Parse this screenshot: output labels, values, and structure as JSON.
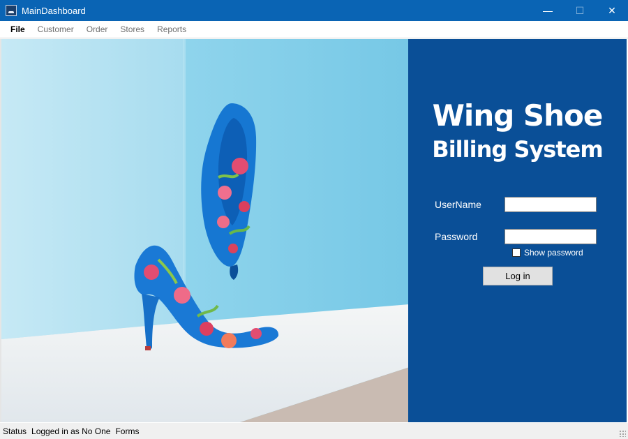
{
  "window": {
    "title": "MainDashboard",
    "minimize_symbol": "—",
    "maximize_symbol": "☐",
    "close_symbol": "✕"
  },
  "menu": {
    "items": [
      {
        "label": "File",
        "active": true
      },
      {
        "label": "Customer"
      },
      {
        "label": "Order"
      },
      {
        "label": "Stores"
      },
      {
        "label": "Reports"
      }
    ]
  },
  "login": {
    "title": "Wing Shoe",
    "subtitle": "Billing System",
    "username_label": "UserName",
    "username_value": "",
    "password_label": "Password",
    "password_value": "",
    "show_password_label": "Show password",
    "show_password_checked": false,
    "login_button": "Log in"
  },
  "status": {
    "label": "Status",
    "logged_in": "Logged in as No One",
    "forms": "Forms"
  },
  "icons": {
    "app": "app-shoe-icon",
    "resize": "resize-grip-icon"
  },
  "colors": {
    "titlebar": "#0A64B4",
    "login_panel": "#0A4F97",
    "photo_wall": "#8FD4EC",
    "photo_floor": "#E9EEF2"
  }
}
